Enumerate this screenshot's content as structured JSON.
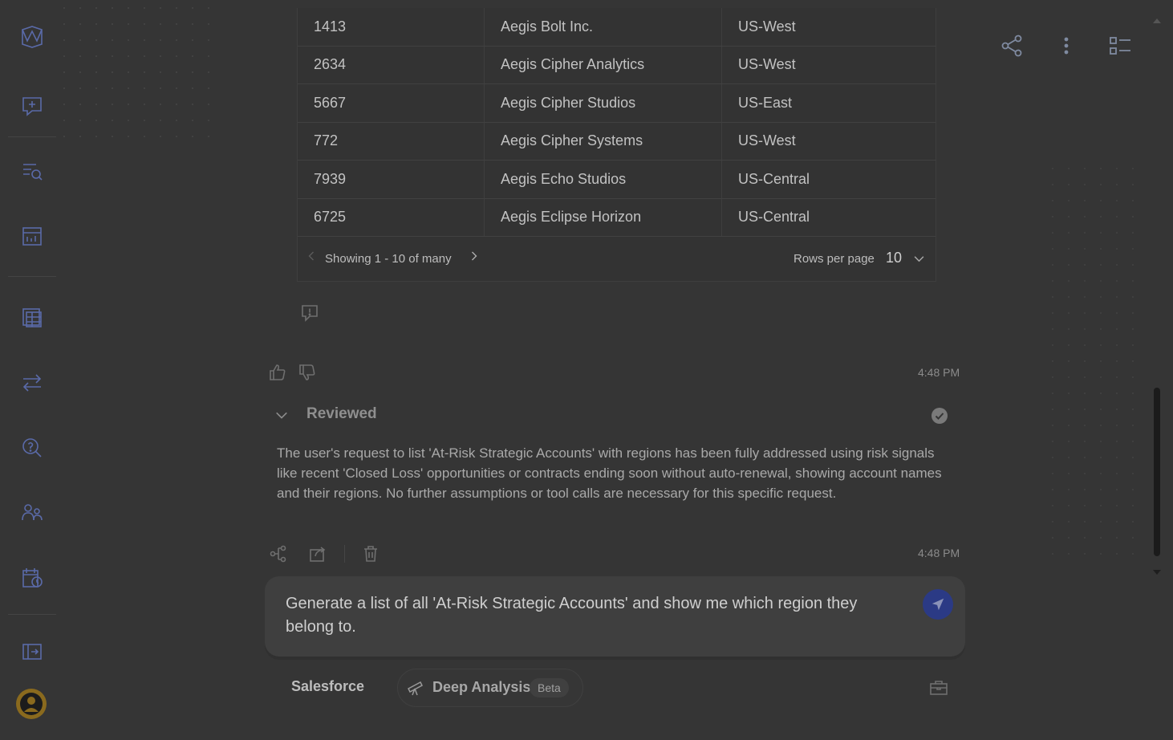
{
  "table": {
    "rows": [
      {
        "id": "1413",
        "name": "Aegis Bolt Inc.",
        "region": "US-West"
      },
      {
        "id": "2634",
        "name": "Aegis Cipher Analytics",
        "region": "US-West"
      },
      {
        "id": "5667",
        "name": "Aegis Cipher Studios",
        "region": "US-East"
      },
      {
        "id": "772",
        "name": "Aegis Cipher Systems",
        "region": "US-West"
      },
      {
        "id": "7939",
        "name": "Aegis Echo Studios",
        "region": "US-Central"
      },
      {
        "id": "6725",
        "name": "Aegis Eclipse Horizon",
        "region": "US-Central"
      }
    ],
    "pagination_text": "Showing 1 - 10 of many",
    "rows_per_page_label": "Rows per page",
    "rows_per_page_value": "10"
  },
  "message1": {
    "timestamp": "4:48 PM"
  },
  "review": {
    "title": "Reviewed",
    "text": "The user's request to list 'At-Risk Strategic Accounts' with regions has been fully addressed using risk signals like recent 'Closed Loss' opportunities or contracts ending soon without auto-renewal, showing account names and their regions. No further assumptions or tool calls are necessary for this specific request.",
    "timestamp": "4:48 PM"
  },
  "composer": {
    "text": "Generate a list of all 'At-Risk Strategic Accounts' and show me which region they belong to."
  },
  "footer": {
    "source": "Salesforce",
    "mode_label": "Deep Analysis",
    "mode_badge": "Beta"
  },
  "colors": {
    "accent": "#2b3a85",
    "background": "#353535",
    "sidebar_icon": "#5a6aa8"
  }
}
